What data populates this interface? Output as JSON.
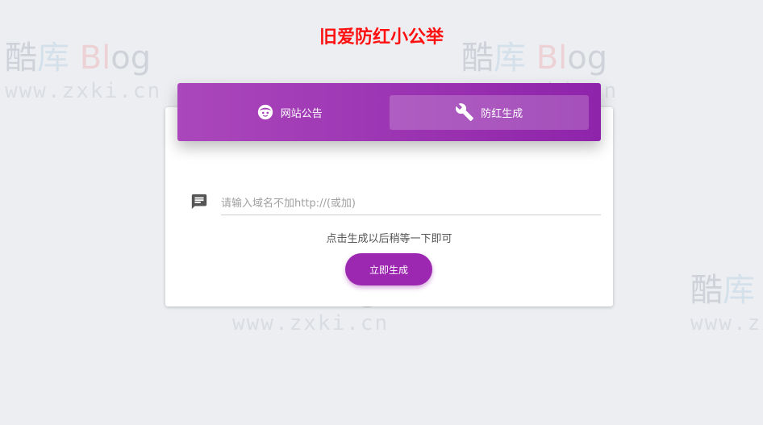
{
  "page": {
    "title": "旧爱防红小公举"
  },
  "tabs": [
    {
      "label": "网站公告",
      "icon": "face-icon",
      "active": false
    },
    {
      "label": "防红生成",
      "icon": "wrench-icon",
      "active": true
    }
  ],
  "form": {
    "input_value": "",
    "input_placeholder": "请输入域名不加http://(或加)",
    "hint": "点击生成以后稍等一下即可",
    "submit_label": "立即生成"
  },
  "watermark": {
    "chars": [
      "酷",
      "库",
      "Bl",
      "og"
    ],
    "url": "www.zxki.cn"
  },
  "colors": {
    "title": "#ff1010",
    "tab_bar_start": "#ab47bc",
    "tab_bar_end": "#8e24aa",
    "button": "#9c27b0",
    "background": "#eceef2"
  }
}
